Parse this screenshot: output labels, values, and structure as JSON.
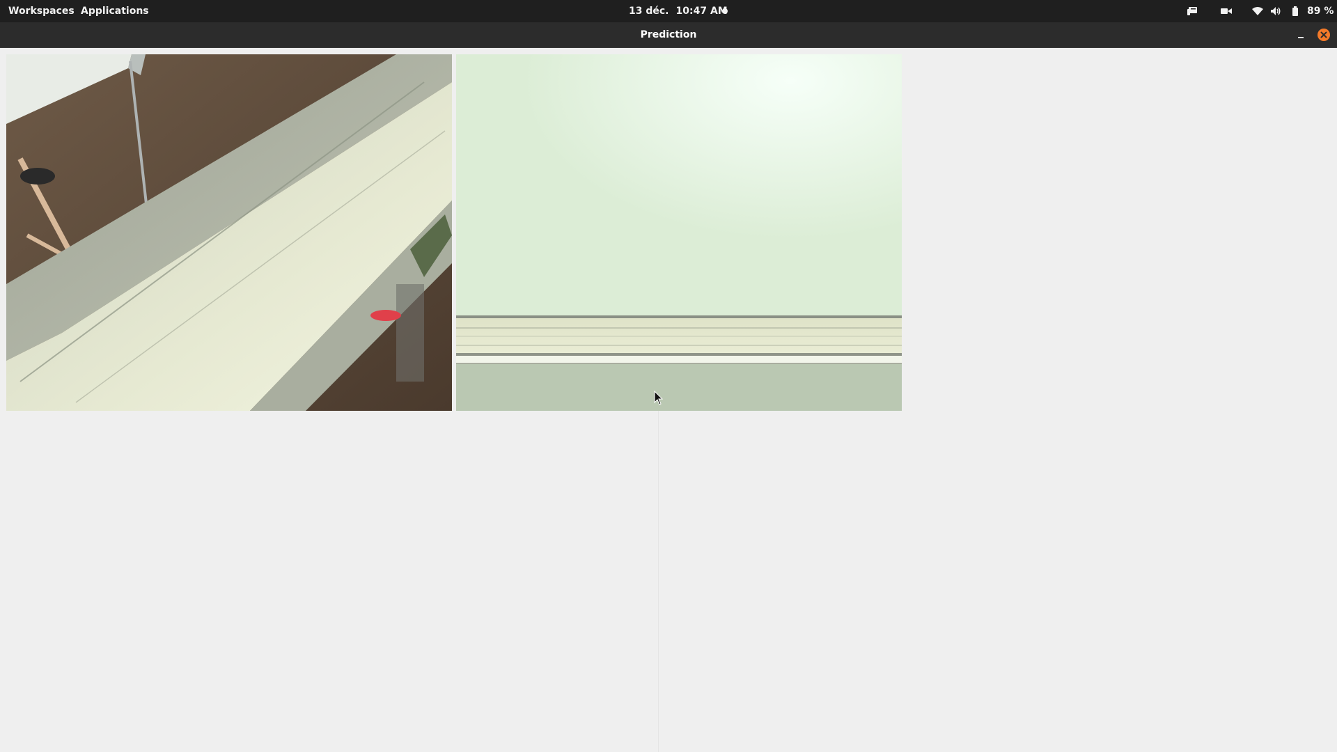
{
  "topbar": {
    "workspaces": "Workspaces",
    "applications": "Applications",
    "date": "13 déc.",
    "time": "10:47 AM",
    "battery": "89 %",
    "icons": [
      "notifications-icon",
      "camera-icon",
      "wifi-icon",
      "volume-icon",
      "battery-icon"
    ]
  },
  "window": {
    "title": "Prediction",
    "close_color": "#f47a29"
  },
  "panels": [
    {
      "name": "camera-feed-left",
      "description_icon": "camera-image"
    },
    {
      "name": "camera-feed-right",
      "description_icon": "camera-image"
    }
  ]
}
